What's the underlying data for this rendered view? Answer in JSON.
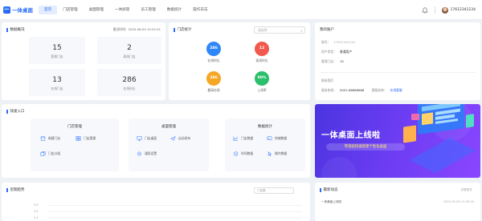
{
  "header": {
    "logo_mark": "一",
    "logo_text": "一体桌面",
    "nav": [
      {
        "label": "首页",
        "active": true
      },
      {
        "label": "门店管理",
        "active": false
      },
      {
        "label": "桌面管理",
        "active": false
      },
      {
        "label": "一体屏管",
        "active": false
      },
      {
        "label": "员工管理",
        "active": false
      },
      {
        "label": "数据统计",
        "active": false
      },
      {
        "label": "操作日志",
        "active": false
      }
    ],
    "username": "17612341234"
  },
  "overview": {
    "title": "数据概况",
    "update_time": "更近时间：2020-06-09 15:41:01",
    "stats": [
      {
        "value": "15",
        "label": "管理门店"
      },
      {
        "value": "2",
        "label": "离线门店"
      },
      {
        "value": "13",
        "label": "在线门店"
      },
      {
        "value": "286",
        "label": "在线时长"
      }
    ]
  },
  "door_stats": {
    "title": "门店统计",
    "select_placeholder": "请选择",
    "items": [
      {
        "value": "286",
        "label": "在线时长",
        "color": "#2f86f6"
      },
      {
        "value": "12",
        "label": "离线时长",
        "color": "#f05a4e"
      },
      {
        "value": "286",
        "label": "最高在线",
        "color": "#f5a623"
      },
      {
        "value": "90%",
        "label": "上线率",
        "color": "#2bbf6b"
      }
    ]
  },
  "account": {
    "title": "我的账户",
    "rows": [
      {
        "label": "账号：",
        "value": "17612341234"
      },
      {
        "label": "用户类型：",
        "value": "普通用户"
      },
      {
        "label": "管理门店：",
        "value": "15"
      }
    ],
    "contact_label": "联系我们",
    "phone_label": "服务热线：",
    "phone": "0001-88888888",
    "service_label": "客服咨询：",
    "service_link": "在线客服"
  },
  "quick_entry": {
    "title": "快速入口",
    "groups": [
      {
        "title": "门店管理",
        "items": [
          "新建门店",
          "门店管理",
          "门店分组"
        ]
      },
      {
        "title": "桌面管理",
        "items": [
          "门店桌面",
          "自动发布",
          "通用设置"
        ]
      },
      {
        "title": "数据统计",
        "items": [
          "门店数据",
          "终端数据",
          "时间数据",
          "操作数据"
        ]
      }
    ]
  },
  "banner": {
    "title": "一体桌面上线啦",
    "subtitle": "零基础快速搭建个性化桌面"
  },
  "trend": {
    "title": "近期趋势",
    "select_value": "门店数",
    "y_ticks": [
      "0.8",
      "0.6",
      "0.4"
    ]
  },
  "news": {
    "title": "最新动态",
    "more": "查看更多",
    "items": [
      {
        "text": "一体桌面上线啦",
        "date": "2020-05-06 12:30:00"
      }
    ]
  },
  "colors": {
    "accent": "#2a6cf6"
  }
}
